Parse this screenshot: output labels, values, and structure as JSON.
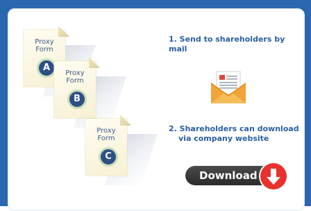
{
  "documents": [
    {
      "title_line1": "Proxy",
      "title_line2": "Form",
      "badge": "A"
    },
    {
      "title_line1": "Proxy",
      "title_line2": "Form",
      "badge": "B"
    },
    {
      "title_line1": "Proxy",
      "title_line2": "Form",
      "badge": "C"
    }
  ],
  "steps": {
    "step1": "1. Send to shareholders by mail",
    "step2_line1": "2. Shareholders can download",
    "step2_line2": "via company website"
  },
  "download": {
    "label": "Download"
  },
  "colors": {
    "frame": "#2a67b0",
    "step_text": "#2a5ea3",
    "badge": "#2e4e86",
    "download_pill": "#333333",
    "download_arrow_bg": "#e8322e",
    "envelope": "#f2a33a"
  },
  "icons": {
    "mail": "envelope-with-letter-icon",
    "download": "arrow-down-icon"
  }
}
